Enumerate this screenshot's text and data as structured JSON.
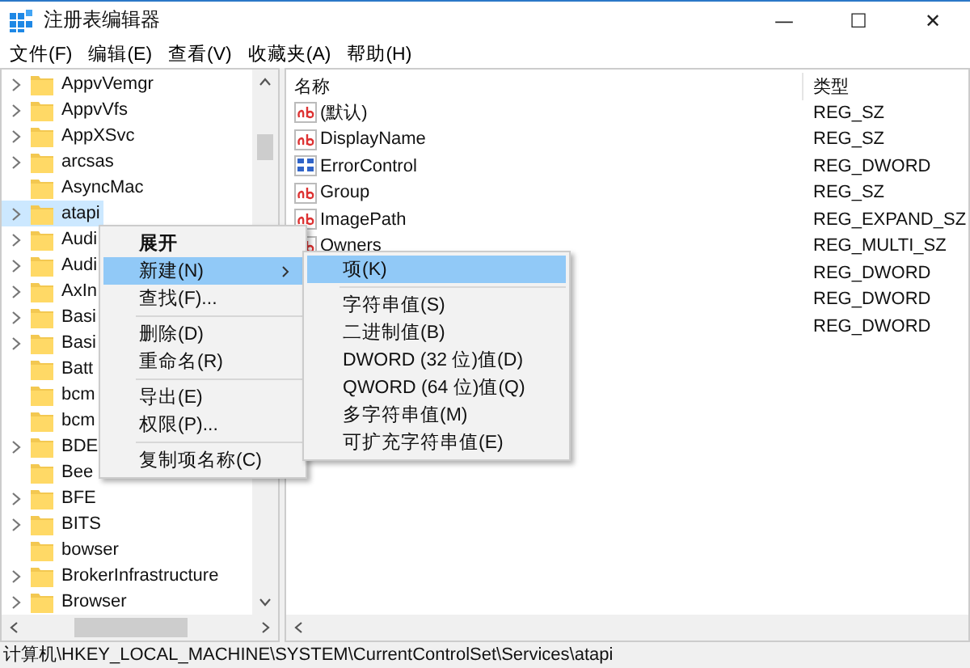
{
  "window": {
    "title": "注册表编辑器",
    "controls": [
      "—",
      "☐",
      "✕"
    ]
  },
  "menu_bar": [
    "文件(F)",
    "编辑(E)",
    "查看(V)",
    "收藏夹(A)",
    "帮助(H)"
  ],
  "tree": {
    "items": [
      {
        "label": "AppvVemgr",
        "expandable": true,
        "selected": false
      },
      {
        "label": "AppvVfs",
        "expandable": true,
        "selected": false
      },
      {
        "label": "AppXSvc",
        "expandable": true,
        "selected": false
      },
      {
        "label": "arcsas",
        "expandable": true,
        "selected": false
      },
      {
        "label": "AsyncMac",
        "expandable": false,
        "selected": false
      },
      {
        "label": "atapi",
        "expandable": true,
        "selected": true
      },
      {
        "label": "Audi",
        "expandable": true,
        "selected": false
      },
      {
        "label": "Audi",
        "expandable": true,
        "selected": false
      },
      {
        "label": "AxIn",
        "expandable": true,
        "selected": false
      },
      {
        "label": "Basi",
        "expandable": true,
        "selected": false
      },
      {
        "label": "Basi",
        "expandable": true,
        "selected": false
      },
      {
        "label": "Batt",
        "expandable": false,
        "selected": false
      },
      {
        "label": "bcm",
        "expandable": false,
        "selected": false
      },
      {
        "label": "bcm",
        "expandable": false,
        "selected": false
      },
      {
        "label": "BDE",
        "expandable": true,
        "selected": false
      },
      {
        "label": "Bee",
        "expandable": false,
        "selected": false
      },
      {
        "label": "BFE",
        "expandable": true,
        "selected": false
      },
      {
        "label": "BITS",
        "expandable": true,
        "selected": false
      },
      {
        "label": "bowser",
        "expandable": false,
        "selected": false
      },
      {
        "label": "BrokerInfrastructure",
        "expandable": true,
        "selected": false
      },
      {
        "label": "Browser",
        "expandable": true,
        "selected": false
      }
    ]
  },
  "values": {
    "columns": [
      "名称",
      "类型"
    ],
    "rows": [
      {
        "name": "(默认)",
        "kind": "string",
        "type": "REG_SZ"
      },
      {
        "name": "DisplayName",
        "kind": "string",
        "type": "REG_SZ"
      },
      {
        "name": "ErrorControl",
        "kind": "binary",
        "type": "REG_DWORD"
      },
      {
        "name": "Group",
        "kind": "string",
        "type": "REG_SZ"
      },
      {
        "name": "ImagePath",
        "kind": "string",
        "type": "REG_EXPAND_SZ"
      },
      {
        "name": "Owners",
        "kind": "string",
        "type": "REG_MULTI_SZ"
      },
      {
        "type": "REG_DWORD"
      },
      {
        "type": "REG_DWORD"
      },
      {
        "type": "REG_DWORD"
      }
    ]
  },
  "context_menu": {
    "items": [
      {
        "kind": "item",
        "label": "展开",
        "bold": true,
        "selected": false,
        "submenu": false
      },
      {
        "kind": "item",
        "label": "新建(N)",
        "bold": false,
        "selected": true,
        "submenu": true
      },
      {
        "kind": "item",
        "label": "查找(F)...",
        "bold": false,
        "selected": false,
        "submenu": false
      },
      {
        "kind": "separator"
      },
      {
        "kind": "item",
        "label": "删除(D)",
        "bold": false,
        "selected": false,
        "submenu": false
      },
      {
        "kind": "item",
        "label": "重命名(R)",
        "bold": false,
        "selected": false,
        "submenu": false
      },
      {
        "kind": "separator"
      },
      {
        "kind": "item",
        "label": "导出(E)",
        "bold": false,
        "selected": false,
        "submenu": false
      },
      {
        "kind": "item",
        "label": "权限(P)...",
        "bold": false,
        "selected": false,
        "submenu": false
      },
      {
        "kind": "separator"
      },
      {
        "kind": "item",
        "label": "复制项名称(C)",
        "bold": false,
        "selected": false,
        "submenu": false
      }
    ]
  },
  "submenu": {
    "items": [
      {
        "kind": "item",
        "label": "项(K)",
        "selected": true
      },
      {
        "kind": "separator"
      },
      {
        "kind": "item",
        "label": "字符串值(S)",
        "selected": false
      },
      {
        "kind": "item",
        "label": "二进制值(B)",
        "selected": false
      },
      {
        "kind": "item",
        "label": "DWORD (32 位)值(D)",
        "selected": false
      },
      {
        "kind": "item",
        "label": "QWORD (64 位)值(Q)",
        "selected": false
      },
      {
        "kind": "item",
        "label": "多字符串值(M)",
        "selected": false
      },
      {
        "kind": "item",
        "label": "可扩充字符串值(E)",
        "selected": false
      }
    ]
  },
  "status_bar": "计算机\\HKEY_LOCAL_MACHINE\\SYSTEM\\CurrentControlSet\\Services\\atapi"
}
